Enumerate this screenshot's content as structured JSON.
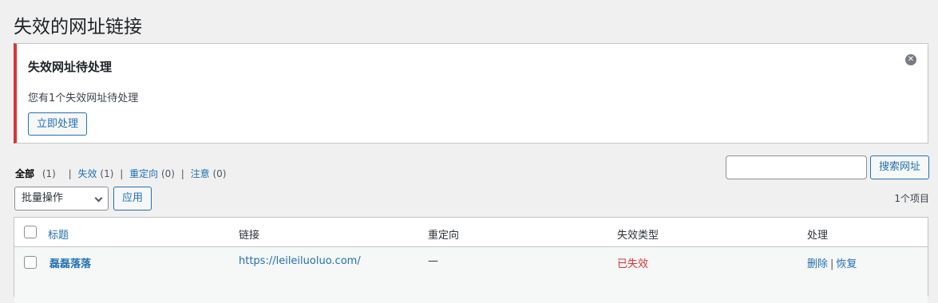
{
  "page": {
    "title": "失效的网址链接"
  },
  "notice": {
    "title": "失效网址待处理",
    "message": "您有1个失效网址待处理",
    "button_label": "立即处理",
    "dismiss_glyph": "✕"
  },
  "filters": {
    "all_label": "全部",
    "all_count": "(1)",
    "broken_label": "失效",
    "broken_count": "(1)",
    "redirect_label": "重定向",
    "redirect_count": "(0)",
    "notice_label": "注意",
    "notice_count": "(0)",
    "separator": "|"
  },
  "search": {
    "value": "",
    "button_label": "搜索网址"
  },
  "bulk": {
    "selected": "批量操作",
    "apply_label": "应用"
  },
  "items_count": "1个项目",
  "table": {
    "headers": {
      "title": "标题",
      "link": "链接",
      "redirect": "重定向",
      "type": "失效类型",
      "action": "处理"
    },
    "rows": [
      {
        "title": "磊磊落落",
        "link": "https://leileiluoluo.com/",
        "redirect": "—",
        "type": "已失效",
        "action_delete": "删除",
        "action_sep": "|",
        "action_restore": "恢复"
      }
    ]
  },
  "colors": {
    "accent": "#2271b1",
    "error": "#d63638",
    "background": "#f0f0f1"
  }
}
